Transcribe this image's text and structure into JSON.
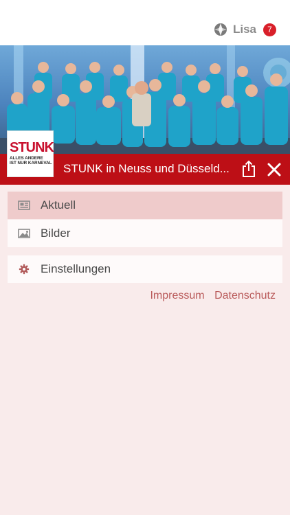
{
  "header": {
    "user_name": "Lisa",
    "notification_count": "7",
    "user_icon": "gear-like-account-icon"
  },
  "hero": {
    "image": "group-photo-stunk-ensemble",
    "logo_main": "STUNK",
    "logo_sub_line1": "ALLES ANDERE",
    "logo_sub_line2": "IST NUR KARNEVAL"
  },
  "titlebar": {
    "title": "STUNK in Neuss und Düsseld...",
    "share_icon": "share-icon",
    "close_icon": "close-icon"
  },
  "menu": {
    "items": [
      {
        "label": "Aktuell",
        "icon": "news-icon"
      },
      {
        "label": "Bilder",
        "icon": "image-icon"
      }
    ],
    "settings_label": "Einstellungen",
    "settings_icon": "gear-icon"
  },
  "footer": {
    "impressum": "Impressum",
    "datenschutz": "Datenschutz"
  },
  "colors": {
    "accent_red": "#bd0f16",
    "background": "#f9ebeb",
    "active_row": "#efcbcb",
    "link": "#b95a5a"
  }
}
